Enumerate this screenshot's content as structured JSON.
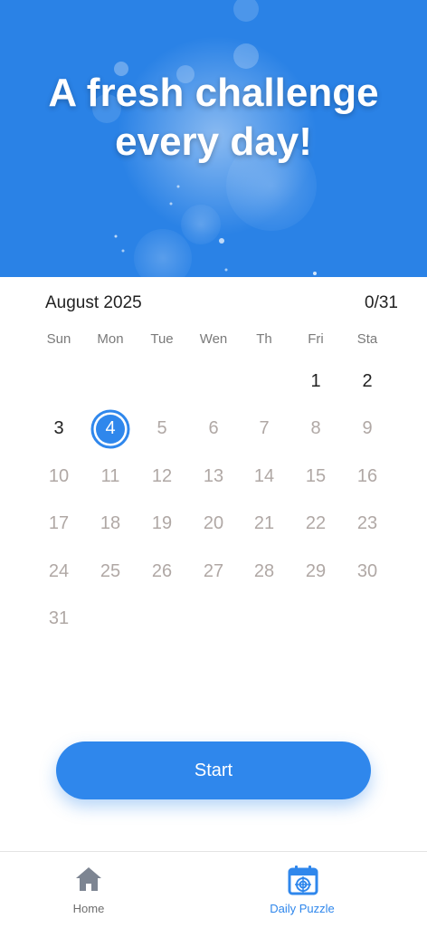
{
  "hero": {
    "title_line1": "A fresh challenge",
    "title_line2": "every day!"
  },
  "calendar": {
    "month_label": "August 2025",
    "progress": "0/31",
    "weekdays": [
      "Sun",
      "Mon",
      "Tue",
      "Wen",
      "Th",
      "Fri",
      "Sta"
    ],
    "first_weekday_index": 5,
    "days_in_month": 31,
    "selected_day": 4,
    "available_days": [
      1,
      2,
      3,
      4
    ]
  },
  "start_button": {
    "label": "Start"
  },
  "bottom_nav": {
    "items": [
      {
        "label": "Home",
        "icon": "home-icon",
        "active": false
      },
      {
        "label": "Daily Puzzle",
        "icon": "calendar-target-icon",
        "active": true
      }
    ]
  },
  "colors": {
    "accent": "#2f87ec",
    "hero_bg": "#2a82e6",
    "muted_day": "#b0a8a5",
    "text": "#222222"
  }
}
